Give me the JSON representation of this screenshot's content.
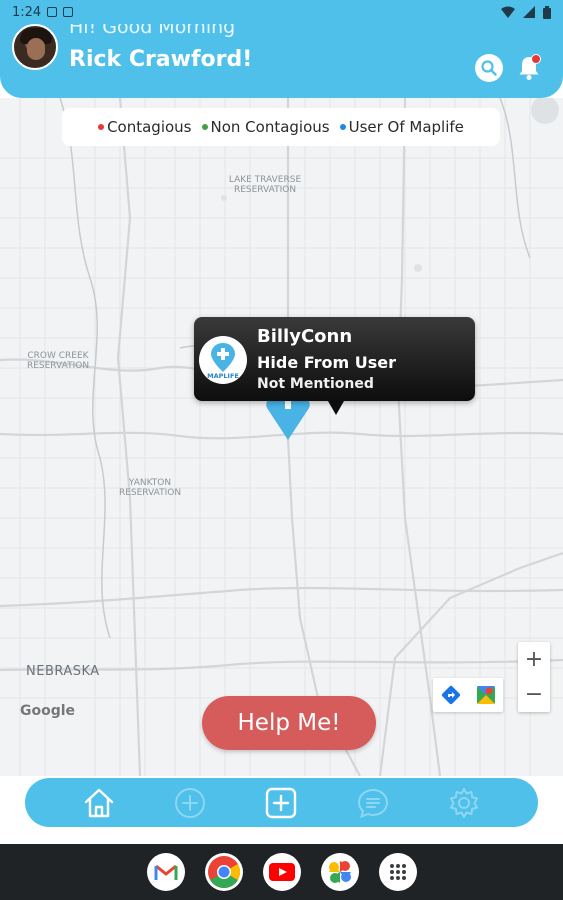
{
  "status_bar": {
    "time": "1:24"
  },
  "header": {
    "greeting": "Hi! Good Morning",
    "username": "Rick Crawford!"
  },
  "legend": {
    "items": [
      {
        "label": "Contagious",
        "color": "#e53935"
      },
      {
        "label": "Non Contagious",
        "color": "#43a047"
      },
      {
        "label": "User Of  Maplife",
        "color": "#1e88e5"
      }
    ]
  },
  "map": {
    "labels": {
      "lake_traverse": "LAKE TRAVERSE RESERVATION",
      "crow_creek": "CROW CREEK RESERVATION",
      "yankton": "YANKTON RESERVATION",
      "nebraska": "NEBRASKA"
    },
    "google": "Google"
  },
  "info_window": {
    "name": "BillyConn",
    "status": "Hide From User",
    "note": "Not Mentioned",
    "logo_text": "MAPLIFE"
  },
  "zoom": {
    "in_label": "+",
    "out_label": "−"
  },
  "help_button": {
    "label": "Help Me!"
  },
  "colors": {
    "primary": "#4ec0ea",
    "help": "#d65c5c",
    "pin": "#4ab3e6"
  }
}
